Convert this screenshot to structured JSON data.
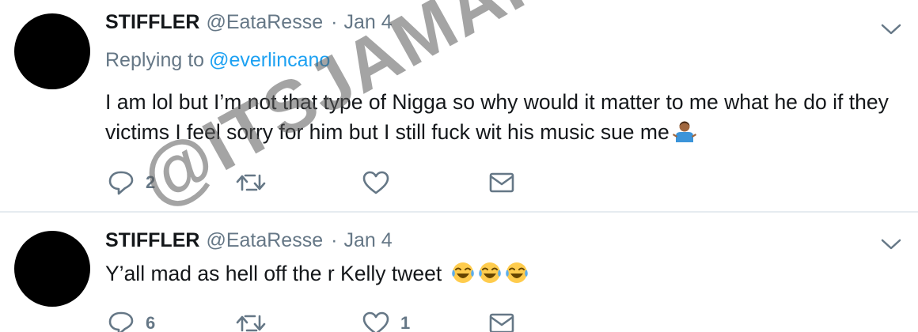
{
  "tweets": [
    {
      "name": "STIFFLER",
      "handle": "@EataResse",
      "separator": "·",
      "date": "Jan 4",
      "replying_prefix": "Replying to",
      "replying_to": "@everlincano",
      "text": "I am lol but I’m not that type of Nigga so why would it matter to me what he do if they victims I feel sorry for him but I still fuck wit his music sue me",
      "emoji": [
        "person-shrugging-emoji"
      ],
      "reply_count": "2",
      "retweet_count": "",
      "like_count": "",
      "icons": [
        "chevron-down-icon",
        "reply-icon",
        "retweet-icon",
        "heart-icon",
        "envelope-icon"
      ]
    },
    {
      "name": "STIFFLER",
      "handle": "@EataResse",
      "separator": "·",
      "date": "Jan 4",
      "text": "Y’all mad as hell off the r Kelly tweet",
      "emoji": [
        "face-with-tears-of-joy-emoji",
        "face-with-tears-of-joy-emoji",
        "face-with-tears-of-joy-emoji"
      ],
      "reply_count": "6",
      "retweet_count": "",
      "like_count": "1",
      "icons": [
        "chevron-down-icon",
        "reply-icon",
        "retweet-icon",
        "heart-icon",
        "envelope-icon"
      ]
    }
  ],
  "watermark": "@ITSJAMARIFOX",
  "colors": {
    "text": "#14171a",
    "secondary": "#657786",
    "link": "#1da1f2",
    "divider": "#e6ecf0"
  }
}
